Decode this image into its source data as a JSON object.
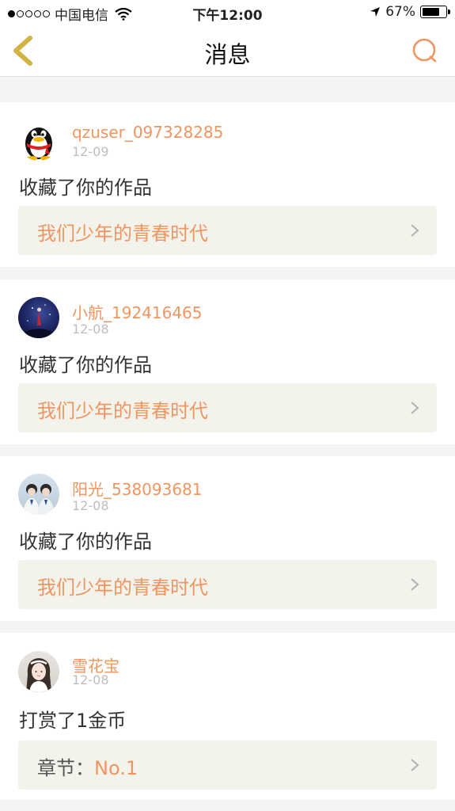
{
  "status_bar": {
    "carrier": "中国电信",
    "time": "下午12:00",
    "battery": "67%",
    "signal_bars_filled": 1,
    "signal_bars_total": 5,
    "battery_level": 0.67
  },
  "nav": {
    "title": "消息",
    "back_icon": "chevron-left-icon",
    "search_icon": "search-icon"
  },
  "colors": {
    "accent": "#ef9561",
    "back_icon": "#d4b244",
    "card_link_bg": "#f3f3ec",
    "date": "#bdbdbd"
  },
  "messages": [
    {
      "username": "qzuser_097328285",
      "date": "12-09",
      "action": "收藏了你的作品",
      "link_text": "我们少年的青春时代",
      "avatar": "qq-penguin-avatar"
    },
    {
      "username": "小航_192416465",
      "date": "12-08",
      "action": "收藏了你的作品",
      "link_text": "我们少年的青春时代",
      "avatar": "night-scene-avatar"
    },
    {
      "username": "阳光_538093681",
      "date": "12-08",
      "action": "收藏了你的作品",
      "link_text": "我们少年的青春时代",
      "avatar": "group-photo-avatar"
    },
    {
      "username": "雪花宝",
      "date": "12-08",
      "action": "打赏了1金币",
      "chapter_label": "章节：",
      "chapter_value": "No.1",
      "avatar": "girl-photo-avatar"
    }
  ]
}
